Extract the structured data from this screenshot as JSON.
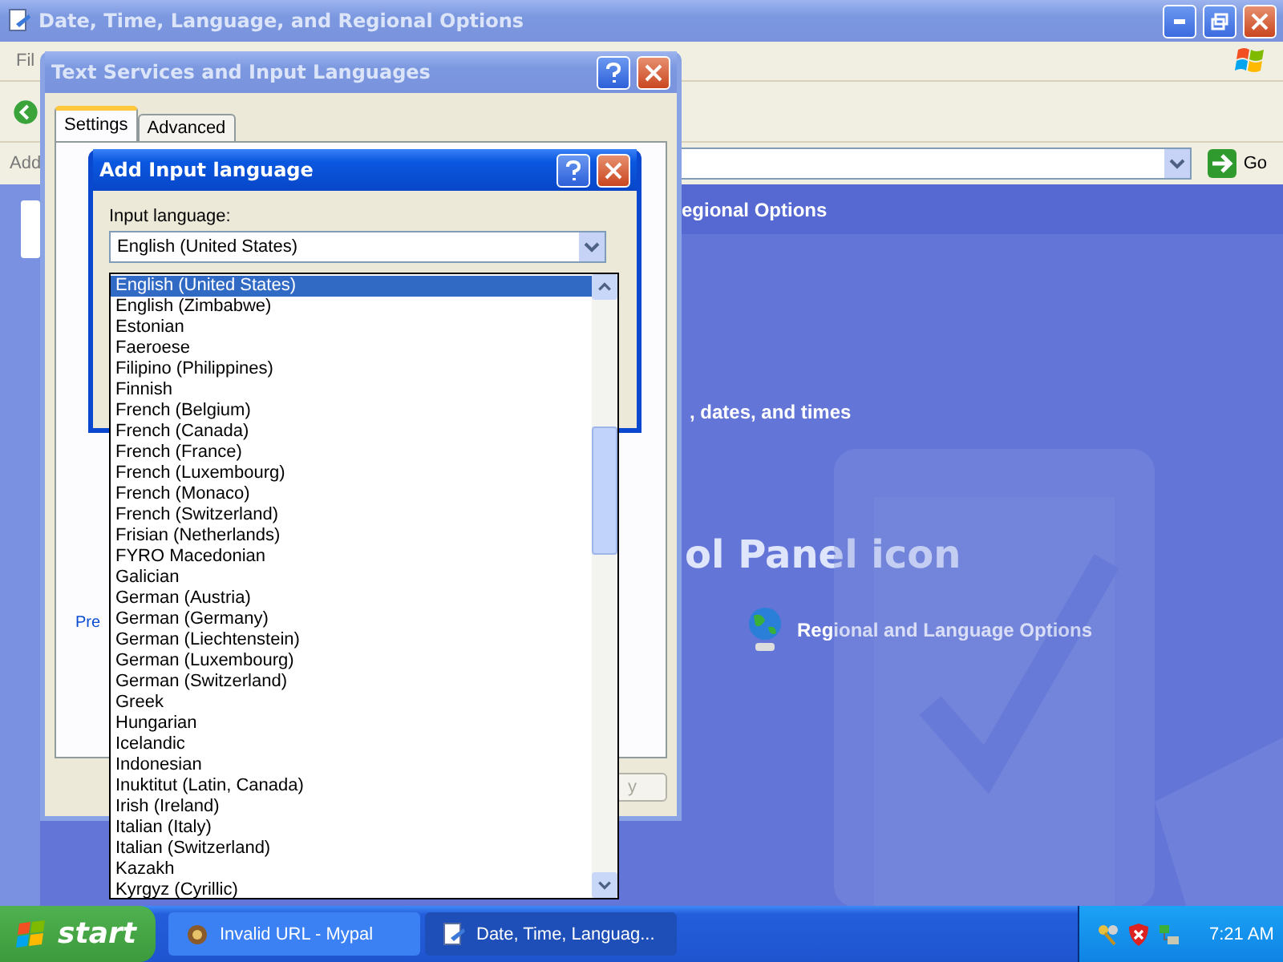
{
  "main_window": {
    "title": "Date, Time, Language, and Regional Options",
    "menu": [
      "Fil"
    ],
    "address_label": "Add",
    "go_label": "Go",
    "header_text": "egional Options",
    "section_text": ", dates, and times",
    "heading": "ol Panel icon",
    "task_link": "Regional and Language Options"
  },
  "text_services_dialog": {
    "title": "Text Services and Input Languages",
    "tabs": [
      {
        "label": "Settings",
        "selected": true
      },
      {
        "label": "Advanced",
        "selected": false
      }
    ],
    "link_text": "Pre",
    "apply_text": "y"
  },
  "add_language_dialog": {
    "title": "Add Input language",
    "field_label": "Input language:",
    "value": "English (United States)",
    "options": [
      {
        "label": "English (United States)",
        "selected": true
      },
      {
        "label": "English (Zimbabwe)",
        "selected": false
      },
      {
        "label": "Estonian",
        "selected": false
      },
      {
        "label": "Faeroese",
        "selected": false
      },
      {
        "label": "Filipino (Philippines)",
        "selected": false
      },
      {
        "label": "Finnish",
        "selected": false
      },
      {
        "label": "French (Belgium)",
        "selected": false
      },
      {
        "label": "French (Canada)",
        "selected": false
      },
      {
        "label": "French (France)",
        "selected": false
      },
      {
        "label": "French (Luxembourg)",
        "selected": false
      },
      {
        "label": "French (Monaco)",
        "selected": false
      },
      {
        "label": "French (Switzerland)",
        "selected": false
      },
      {
        "label": "Frisian (Netherlands)",
        "selected": false
      },
      {
        "label": "FYRO Macedonian",
        "selected": false
      },
      {
        "label": "Galician",
        "selected": false
      },
      {
        "label": "German (Austria)",
        "selected": false
      },
      {
        "label": "German (Germany)",
        "selected": false
      },
      {
        "label": "German (Liechtenstein)",
        "selected": false
      },
      {
        "label": "German (Luxembourg)",
        "selected": false
      },
      {
        "label": "German (Switzerland)",
        "selected": false
      },
      {
        "label": "Greek",
        "selected": false
      },
      {
        "label": "Hungarian",
        "selected": false
      },
      {
        "label": "Icelandic",
        "selected": false
      },
      {
        "label": "Indonesian",
        "selected": false
      },
      {
        "label": "Inuktitut (Latin, Canada)",
        "selected": false
      },
      {
        "label": "Irish (Ireland)",
        "selected": false
      },
      {
        "label": "Italian (Italy)",
        "selected": false
      },
      {
        "label": "Italian (Switzerland)",
        "selected": false
      },
      {
        "label": "Kazakh",
        "selected": false
      },
      {
        "label": "Kyrgyz (Cyrillic)",
        "selected": false
      }
    ]
  },
  "taskbar": {
    "start_label": "start",
    "tasks": [
      {
        "label": "Invalid URL - Mypal",
        "selected": false
      },
      {
        "label": "Date, Time, Languag...",
        "selected": true
      }
    ],
    "clock": "7:21 AM"
  }
}
